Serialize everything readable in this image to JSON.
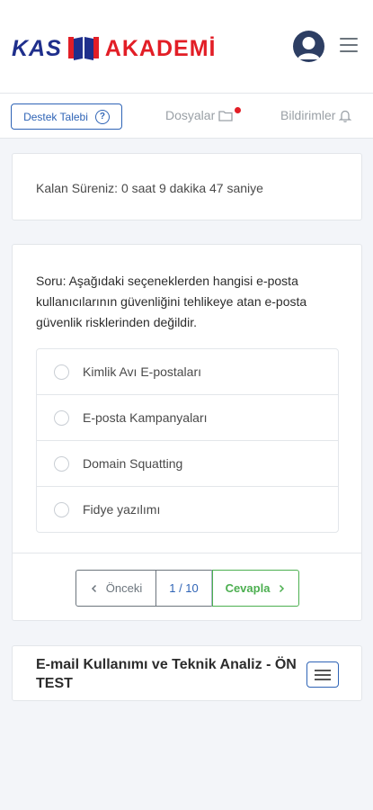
{
  "brand": {
    "left": "KAS",
    "right": "AKADEMİ"
  },
  "subnav": {
    "support_label": "Destek Talebi",
    "files_label": "Dosyalar",
    "notifications_label": "Bildirimler"
  },
  "timer": {
    "text": "Kalan Süreniz: 0 saat 9 dakika 47 saniye"
  },
  "question": {
    "text": "Soru: Aşağıdaki seçeneklerden hangisi e-posta kullanıcılarının güvenliğini tehlikeye atan e-posta güvenlik risklerinden değildir.",
    "options": [
      "Kimlik Avı E-postaları",
      "E-posta Kampanyaları",
      "Domain Squatting",
      "Fidye yazılımı"
    ]
  },
  "pager": {
    "prev_label": "Önceki",
    "page": "1 / 10",
    "next_label": "Cevapla"
  },
  "course": {
    "title": "E-mail Kullanımı ve Teknik Analiz - ÖN TEST"
  },
  "colors": {
    "brand_blue": "#1f2f8c",
    "brand_red": "#e21e26",
    "accent": "#2f64b6",
    "success": "#4caf50"
  }
}
